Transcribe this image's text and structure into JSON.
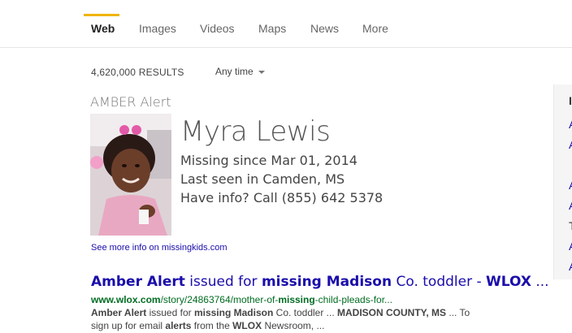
{
  "nav": {
    "tabs": [
      {
        "label": "Web",
        "active": true
      },
      {
        "label": "Images"
      },
      {
        "label": "Videos"
      },
      {
        "label": "Maps"
      },
      {
        "label": "News"
      },
      {
        "label": "More"
      }
    ]
  },
  "toolbar": {
    "results_count": "4,620,000 RESULTS",
    "time_filter": "Any time"
  },
  "amber_card": {
    "label": "AMBER Alert",
    "name": "Myra Lewis",
    "missing_since": "Missing since Mar 01, 2014",
    "last_seen": "Last seen in Camden, MS",
    "have_info": "Have info? Call (855) 642 5378",
    "see_more": "See more info on missingkids.com"
  },
  "result": {
    "title_parts": [
      "Amber Alert",
      " issued for ",
      "missing Madison",
      " Co. toddler - ",
      "WLOX",
      " ..."
    ],
    "url_parts": [
      "www.wlox.com",
      "/story/24863764/mother-of-",
      "missing",
      "-child-pleads-for..."
    ],
    "snippet_line1": [
      "Amber Alert",
      " issued for ",
      "missing Madison",
      " Co. toddler ... ",
      "MADISON COUNTY, MS",
      " ... To"
    ],
    "snippet_line2": [
      "sign up for email ",
      "alerts",
      " from the ",
      "WLOX",
      " Newsroom, ..."
    ]
  },
  "sidebar": {
    "items": [
      "I",
      "A",
      "A",
      "A",
      "A",
      "T",
      "A",
      "A"
    ]
  },
  "colors": {
    "accent": "#f0b400",
    "link": "#1a0dab",
    "url": "#006d21"
  }
}
